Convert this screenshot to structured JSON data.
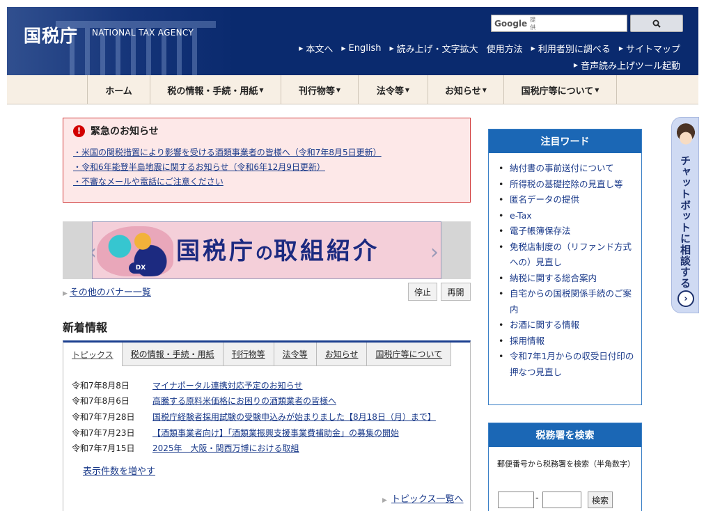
{
  "header": {
    "title": "国税庁",
    "subtitle": "NATIONAL TAX AGENCY",
    "search": {
      "brand": "Google",
      "provided": "提供",
      "placeholder": "",
      "button_icon": "search-icon"
    },
    "util_links": [
      "本文へ",
      "English",
      "読み上げ・文字拡大",
      "使用方法",
      "利用者別に調べる",
      "サイトマップ"
    ],
    "voice_tool": "音声読み上げツール起動"
  },
  "gnav": {
    "items": [
      {
        "label": "ホーム",
        "dropdown": false
      },
      {
        "label": "税の情報・手続・用紙",
        "dropdown": true
      },
      {
        "label": "刊行物等",
        "dropdown": true
      },
      {
        "label": "法令等",
        "dropdown": true
      },
      {
        "label": "お知らせ",
        "dropdown": true
      },
      {
        "label": "国税庁等について",
        "dropdown": true
      }
    ]
  },
  "urgent": {
    "title": "緊急のお知らせ",
    "links": [
      "・米国の関税措置により影響を受ける酒類事業者の皆様へ（令和7年8月5日更新）",
      "・令和6年能登半島地震に関するお知らせ（令和6年12月9日更新）",
      "・不審なメールや電話にご注意ください"
    ]
  },
  "banner": {
    "text_a": "国税庁",
    "text_b": "の",
    "text_c": "取組紹介",
    "badge": "DX",
    "list_link": "その他のバナー一覧",
    "stop": "停止",
    "resume": "再開"
  },
  "news": {
    "title": "新着情報",
    "tabs": [
      "トピックス",
      "税の情報・手続・用紙",
      "刊行物等",
      "法令等",
      "お知らせ",
      "国税庁等について"
    ],
    "items": [
      {
        "date": "令和7年8月8日",
        "title": "マイナポータル連携対応予定のお知らせ"
      },
      {
        "date": "令和7年8月6日",
        "title": "高騰する原料米価格にお困りの酒類業者の皆様へ"
      },
      {
        "date": "令和7年7月28日",
        "title": "国税庁経験者採用試験の受験申込みが始まりました【8月18日（月）まで】"
      },
      {
        "date": "令和7年7月23日",
        "title": "【酒類事業者向け】「酒類業振興支援事業費補助金」の募集の開始"
      },
      {
        "date": "令和7年7月15日",
        "title": "2025年　大阪・関西万博における取組"
      }
    ],
    "more": "表示件数を増やす",
    "topics_list": "トピックス一覧へ"
  },
  "attention": {
    "title": "注目ワード",
    "items": [
      "納付書の事前送付について",
      "所得税の基礎控除の見直し等",
      "匿名データの提供",
      "e-Tax",
      "電子帳簿保存法",
      "免税店制度の（リファンド方式への）見直し",
      "納税に関する総合案内",
      "自宅からの国税関係手続のご案内",
      "お酒に関する情報",
      "採用情報",
      "令和7年1月からの収受日付印の押なつ見直し"
    ]
  },
  "office": {
    "title": "税務署を検索",
    "desc": "郵便番号から税務署を検索（半角数字）",
    "dash": "-",
    "button": "検索"
  },
  "chatbot": {
    "label": "チャットボットに相談する",
    "arrow": "›"
  }
}
